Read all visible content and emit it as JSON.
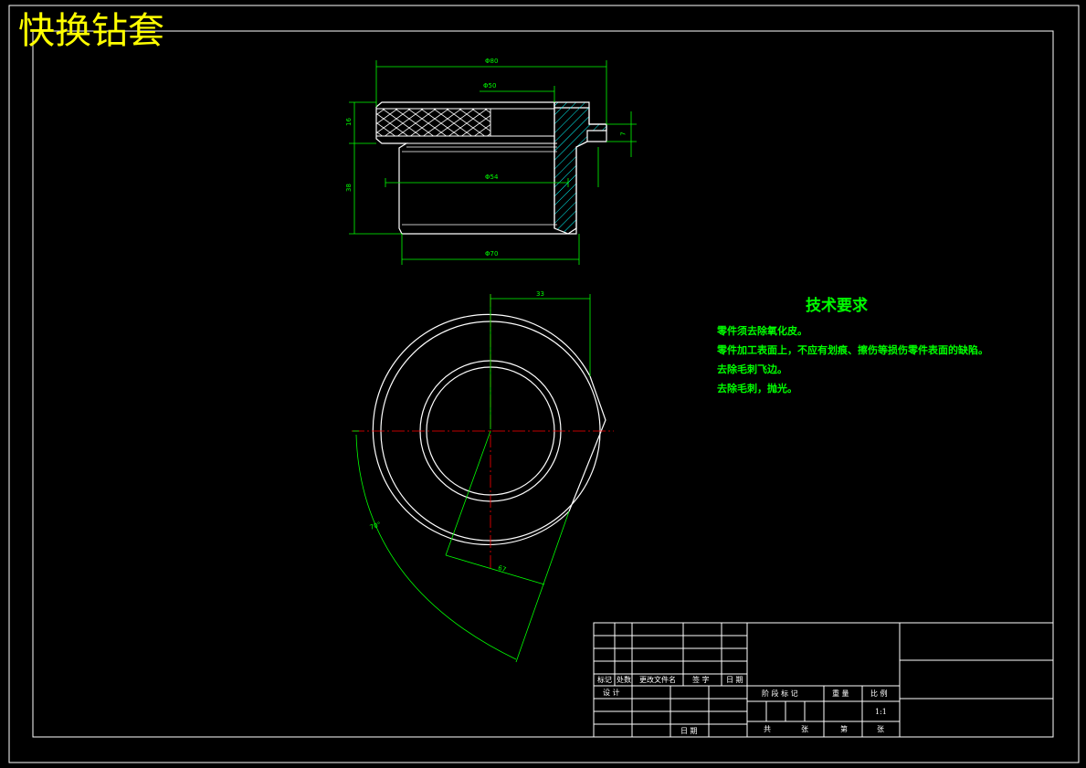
{
  "title": "快换钻套",
  "technical_requirements": {
    "heading": "技术要求",
    "items": [
      "零件须去除氧化皮。",
      "零件加工表面上，不应有划痕、擦伤等损伤零件表面的缺陷。",
      "去除毛刺飞边。",
      "去除毛刺，抛光。"
    ]
  },
  "dimensions": {
    "top_overall": "Φ80",
    "top_inner": "Φ50",
    "bore": "Φ54",
    "bottom": "Φ70",
    "left_knurl": "16",
    "left_body": "38",
    "right_step": "7",
    "radius_offset": "33",
    "angle": "70°",
    "radial": "67"
  },
  "title_block": {
    "headers": [
      "标记",
      "处数",
      "更改文件名",
      "签 字",
      "日 期"
    ],
    "design_label": "设 计",
    "date_label": "日 期",
    "stage_label": "阶 段 标 记",
    "weight_label": "重 量",
    "scale_label": "比 例",
    "scale_value": "1:1",
    "sheets_total_label": "共",
    "sheets_label": "张",
    "page_label": "第",
    "page_suffix": "张"
  },
  "colors": {
    "outline": "#ffffff",
    "dimension": "#00ff00",
    "centerline": "#ff0000",
    "hatch": "#00ffff",
    "title": "#ffff00"
  }
}
